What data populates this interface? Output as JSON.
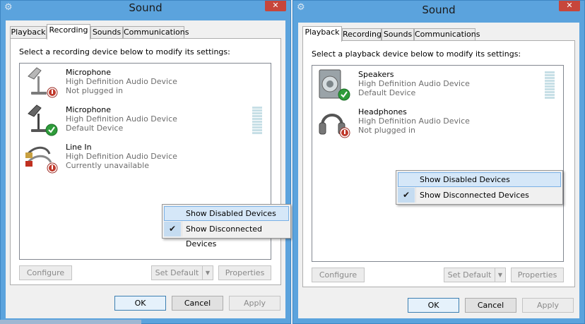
{
  "left": {
    "title": "Sound",
    "tabs": [
      "Playback",
      "Recording",
      "Sounds",
      "Communications"
    ],
    "active_tab": "Recording",
    "instruction": "Select a recording device below to modify its settings:",
    "devices": [
      {
        "name": "Microphone",
        "driver": "High Definition Audio Device",
        "status": "Not plugged in",
        "icon": "microphone-icon",
        "state_icon": "unplugged-icon"
      },
      {
        "name": "Microphone",
        "driver": "High Definition Audio Device",
        "status": "Default Device",
        "icon": "microphone-icon",
        "state_icon": "default-check-icon"
      },
      {
        "name": "Line In",
        "driver": "High Definition Audio Device",
        "status": "Currently unavailable",
        "icon": "line-in-cable-icon",
        "state_icon": "unplugged-icon"
      }
    ],
    "menu": {
      "item1": "Show Disabled Devices",
      "item2": "Show Disconnected Devices",
      "item2_checked": true
    },
    "buttons": {
      "configure": "Configure",
      "set_default": "Set Default",
      "properties": "Properties",
      "ok": "OK",
      "cancel": "Cancel",
      "apply": "Apply"
    }
  },
  "right": {
    "title": "Sound",
    "tabs": [
      "Playback",
      "Recording",
      "Sounds",
      "Communications"
    ],
    "active_tab": "Playback",
    "instruction": "Select a playback device below to modify its settings:",
    "devices": [
      {
        "name": "Speakers",
        "driver": "High Definition Audio Device",
        "status": "Default Device",
        "icon": "speaker-icon",
        "state_icon": "default-check-icon"
      },
      {
        "name": "Headphones",
        "driver": "High Definition Audio Device",
        "status": "Not plugged in",
        "icon": "headphones-icon",
        "state_icon": "unplugged-icon"
      }
    ],
    "menu": {
      "item1": "Show Disabled Devices",
      "item2": "Show Disconnected Devices",
      "item2_checked": true
    },
    "buttons": {
      "configure": "Configure",
      "set_default": "Set Default",
      "properties": "Properties",
      "ok": "OK",
      "cancel": "Cancel",
      "apply": "Apply"
    }
  },
  "glyphs": {
    "close": "✕",
    "check": "✔",
    "dropdown": "▼",
    "sysicon": "⚙"
  },
  "colors": {
    "title_bar": "#5ba3dd",
    "default_check": "#2e9c3a",
    "unplugged_badge": "#c0392b"
  }
}
